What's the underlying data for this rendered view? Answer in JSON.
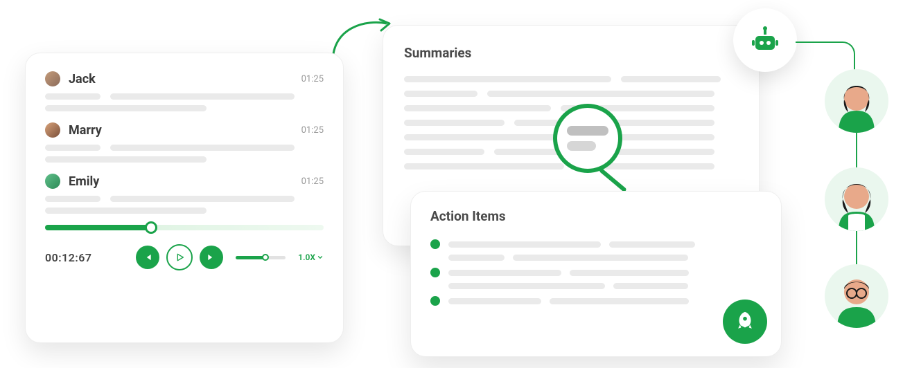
{
  "colors": {
    "accent": "#1aa34a"
  },
  "transcript": {
    "speakers": [
      {
        "name": "Jack",
        "time": "01:25"
      },
      {
        "name": "Marry",
        "time": "01:25"
      },
      {
        "name": "Emily",
        "time": "01:25"
      }
    ],
    "elapsed": "00:12:67",
    "speed": "1.0X",
    "progress_percent": 38,
    "volume_percent": 60
  },
  "summaries": {
    "title": "Summaries"
  },
  "action_items": {
    "title": "Action Items",
    "bullet_count": 3
  },
  "bot": {
    "icon": "robot-icon"
  },
  "people": [
    {
      "id": "person-1"
    },
    {
      "id": "person-2"
    },
    {
      "id": "person-3"
    }
  ]
}
